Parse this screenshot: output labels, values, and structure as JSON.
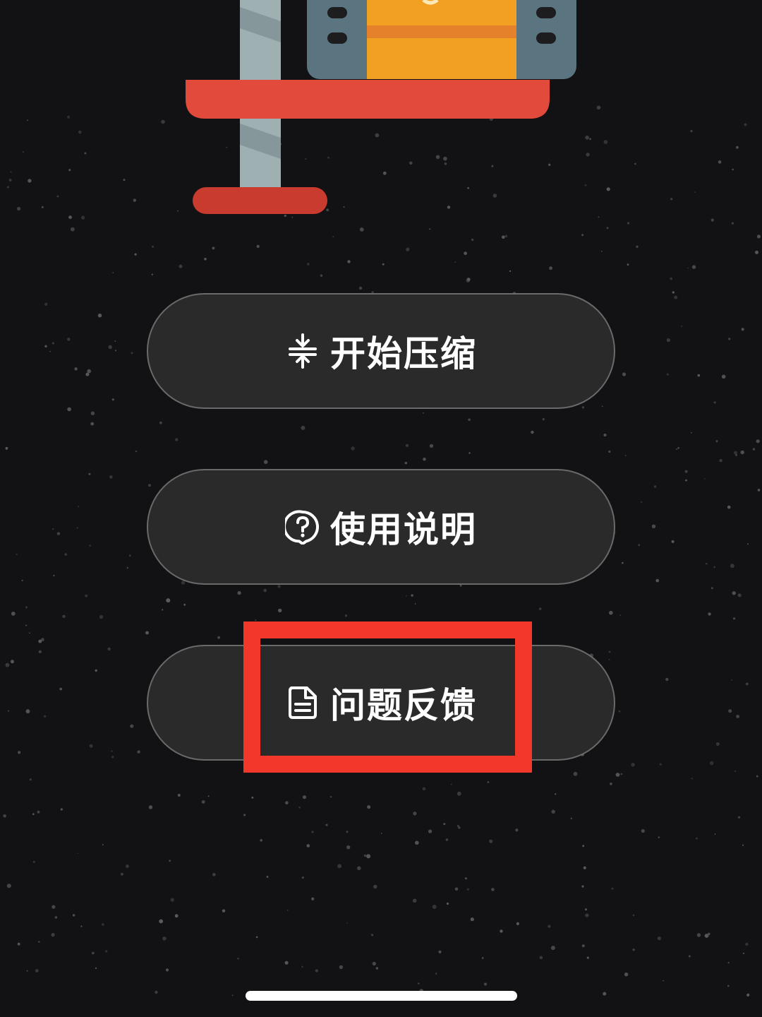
{
  "menu": {
    "compress_label": "开始压缩",
    "guide_label": "使用说明",
    "feedback_label": "问题反馈"
  },
  "colors": {
    "background": "#121114",
    "button_fill": "#2a2a2b",
    "button_border": "#6a6a6a",
    "highlight": "#f2382b",
    "platform_red": "#e24b3b",
    "box_orange": "#f2a022",
    "box_frame": "#5a7580"
  },
  "icons": {
    "compress": "compress-vertical-icon",
    "guide": "question-bubble-icon",
    "feedback": "document-icon"
  }
}
